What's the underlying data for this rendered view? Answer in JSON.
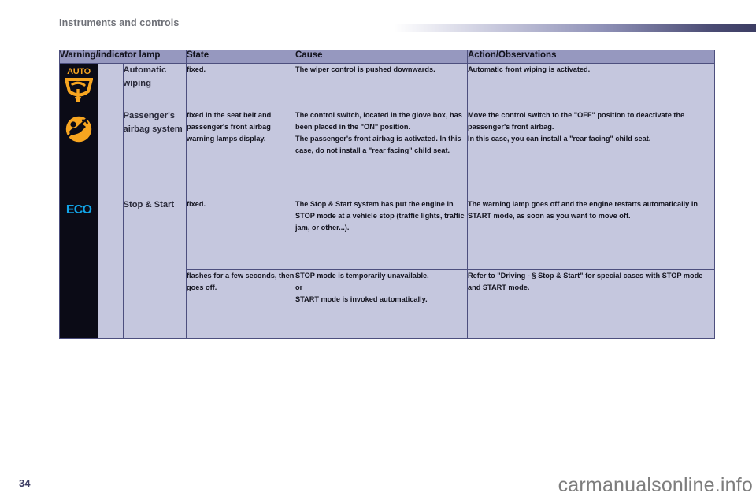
{
  "header": {
    "title": "Instruments and controls",
    "rule_gradient_from": "#ffffff",
    "rule_gradient_to": "#3c3d63"
  },
  "table": {
    "columns": [
      "Warning/indicator lamp",
      "State",
      "Cause",
      "Action/Observations"
    ],
    "rows": [
      {
        "icon": "auto-wiping-icon",
        "icon_label": "AUTO",
        "name": "Automatic\nwiping",
        "state": "fixed.",
        "cause": "The wiper control is pushed downwards.",
        "action": "Automatic front wiping is activated."
      },
      {
        "icon": "passenger-airbag-icon",
        "icon_label": "",
        "name": "Passenger's\nairbag system",
        "state": "fixed in the seat belt and passenger's front airbag warning lamps display.",
        "cause": "The control switch, located in the glove box, has been placed in the \"ON\" position.\nThe passenger's front airbag is activated. In this case, do not install a \"rear facing\" child seat.",
        "action": "Move the control switch to the \"OFF\" position to deactivate the passenger's front airbag.\nIn this case, you can install a \"rear facing\" child seat."
      },
      {
        "icon": "eco-stop-start-icon",
        "icon_label": "ECO",
        "name": "Stop & Start",
        "state": "fixed.",
        "cause": "The Stop & Start system has put the engine in STOP mode at a vehicle stop (traffic lights, traffic jam, or other...).",
        "action": "The warning lamp goes off and the engine restarts automatically in START mode, as soon as you want to move off."
      },
      {
        "icon": "",
        "icon_label": "",
        "name": "",
        "state": "flashes for a few seconds, then goes off.",
        "cause": "STOP mode is temporarily unavailable.\nor\nSTART mode is invoked automatically.",
        "action": "Refer to \"Driving - § Stop & Start\" for special cases with STOP mode and START mode."
      }
    ]
  },
  "footer": {
    "page_number": "34",
    "watermark": "carmanualsonline.info"
  },
  "colors": {
    "header_row": "#9698bf",
    "cell_bg": "#c5c7de",
    "border": "#4d4f7e",
    "icon_bg": "#0b0b16",
    "amber": "#f7a520",
    "cyan": "#12a5e8",
    "title_text": "#6f7178"
  }
}
